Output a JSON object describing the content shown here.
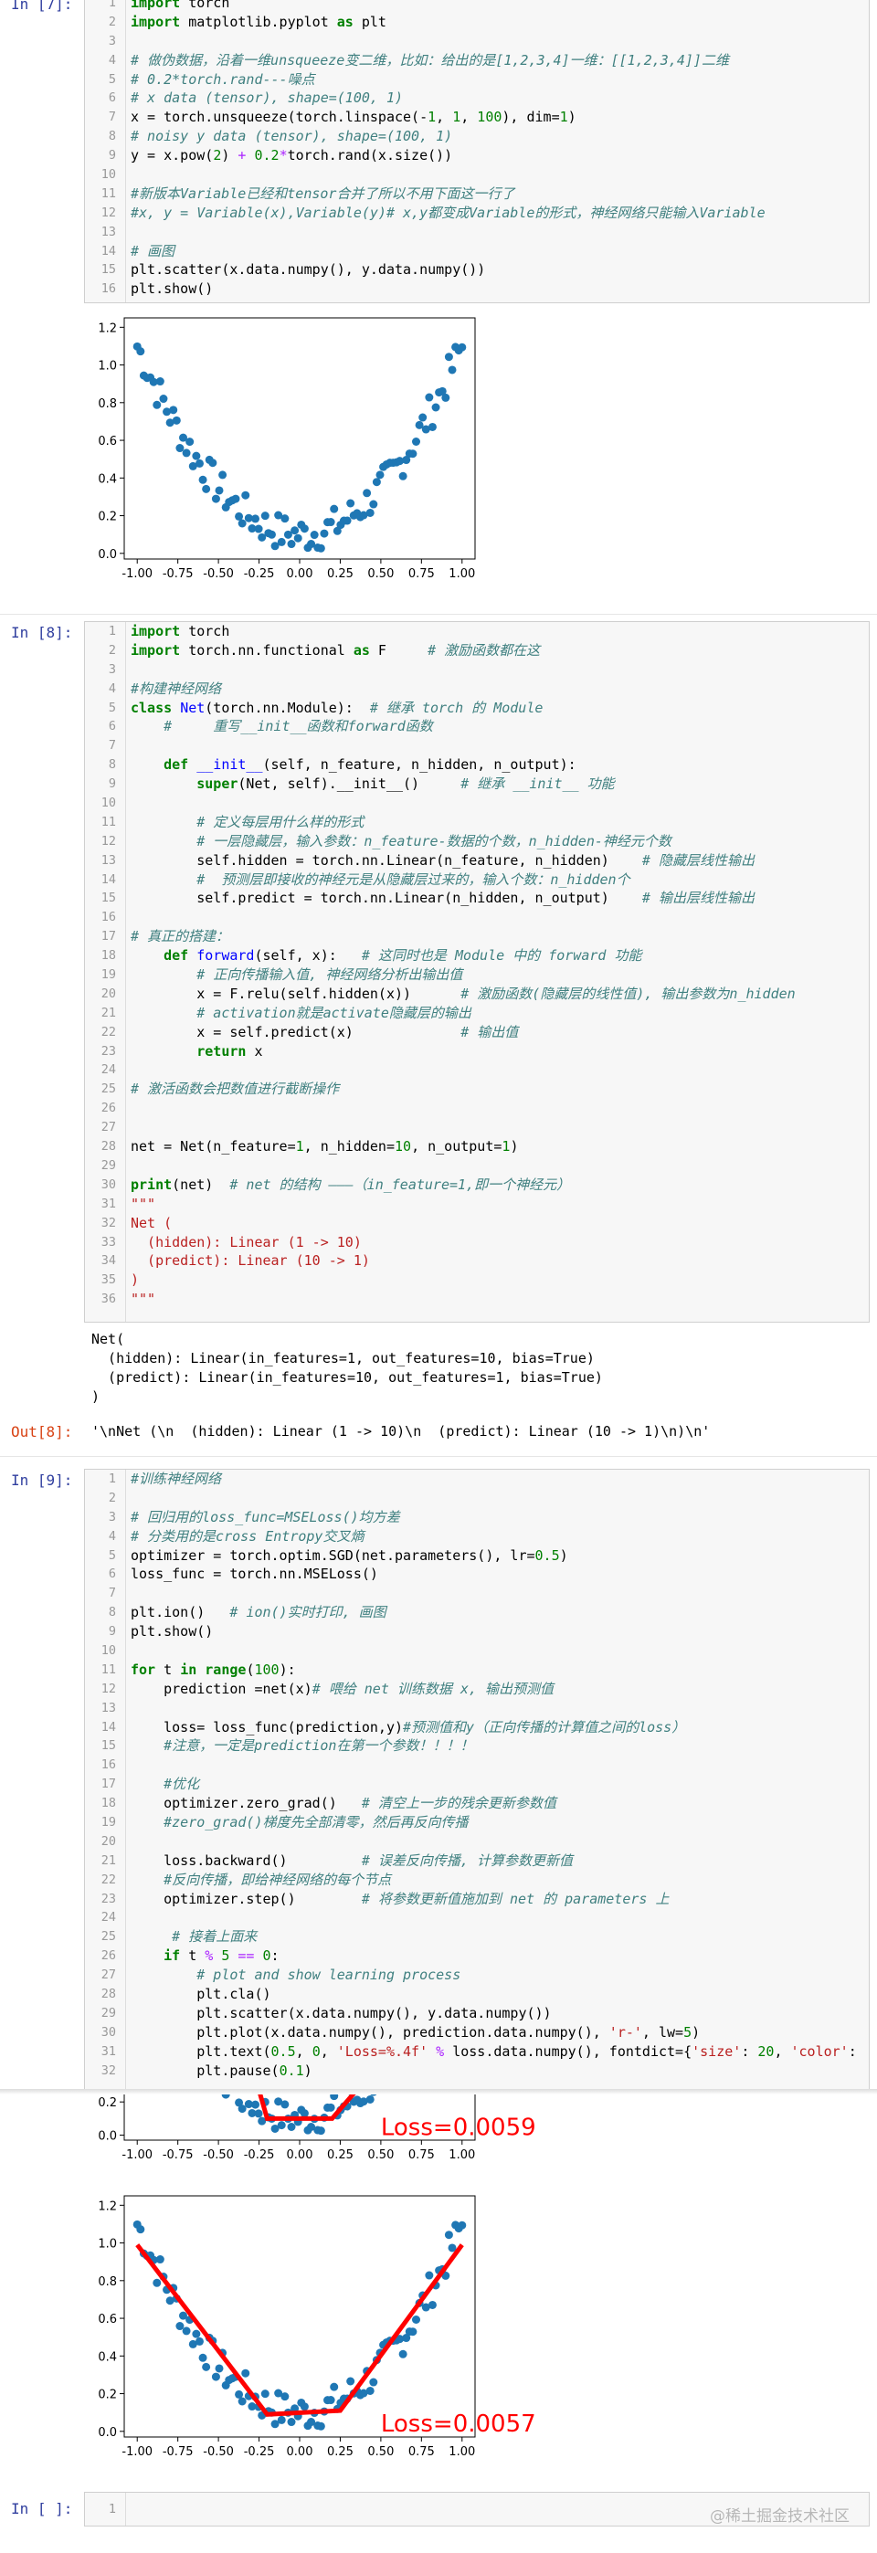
{
  "cells": [
    {
      "prompt": "In [7]:",
      "lines": [
        [
          [
            "kw",
            "import"
          ],
          [
            "t",
            " torch"
          ]
        ],
        [
          [
            "kw",
            "import"
          ],
          [
            "t",
            " matplotlib.pyplot "
          ],
          [
            "kw",
            "as"
          ],
          [
            "t",
            " plt"
          ]
        ],
        [
          [
            "t",
            ""
          ]
        ],
        [
          [
            "cm",
            "# 做伪数据，沿着一维unsqueeze变二维，比如：给出的是[1,2,3,4]一维：[[1,2,3,4]]二维"
          ]
        ],
        [
          [
            "cm",
            "# 0.2*torch.rand---噪点"
          ]
        ],
        [
          [
            "cm",
            "# x data (tensor), shape=(100, 1)"
          ]
        ],
        [
          [
            "t",
            "x = torch.unsqueeze(torch.linspace(-"
          ],
          [
            "num",
            "1"
          ],
          [
            "t",
            ", "
          ],
          [
            "num",
            "1"
          ],
          [
            "t",
            ", "
          ],
          [
            "num",
            "100"
          ],
          [
            "t",
            "), dim="
          ],
          [
            "num",
            "1"
          ],
          [
            "t",
            ")"
          ]
        ],
        [
          [
            "cm",
            "# noisy y data (tensor), shape=(100, 1)"
          ]
        ],
        [
          [
            "t",
            "y = x.pow("
          ],
          [
            "num",
            "2"
          ],
          [
            "t",
            ") "
          ],
          [
            "op",
            "+"
          ],
          [
            "t",
            " "
          ],
          [
            "num",
            "0.2"
          ],
          [
            "op",
            "*"
          ],
          [
            "t",
            "torch.rand(x.size())"
          ]
        ],
        [
          [
            "t",
            ""
          ]
        ],
        [
          [
            "cm",
            "#新版本Variable已经和tensor合并了所以不用下面这一行了"
          ]
        ],
        [
          [
            "cm",
            "#x, y = Variable(x),Variable(y)# x,y都变成Variable的形式，神经网络只能输入Variable"
          ]
        ],
        [
          [
            "t",
            ""
          ]
        ],
        [
          [
            "cm",
            "# 画图"
          ]
        ],
        [
          [
            "t",
            "plt.scatter(x.data.numpy(), y.data.numpy())"
          ]
        ],
        [
          [
            "t",
            "plt.show()"
          ]
        ]
      ]
    },
    {
      "prompt": "In [8]:",
      "lines": [
        [
          [
            "kw",
            "import"
          ],
          [
            "t",
            " torch"
          ]
        ],
        [
          [
            "kw",
            "import"
          ],
          [
            "t",
            " torch.nn.functional "
          ],
          [
            "kw",
            "as"
          ],
          [
            "t",
            " F     "
          ],
          [
            "cm",
            "# 激励函数都在这"
          ]
        ],
        [
          [
            "t",
            ""
          ]
        ],
        [
          [
            "cm",
            "#构建神经网络"
          ]
        ],
        [
          [
            "kw",
            "class"
          ],
          [
            "t",
            " "
          ],
          [
            "fn",
            "Net"
          ],
          [
            "t",
            "(torch.nn.Module):  "
          ],
          [
            "cm",
            "# 继承 torch 的 Module"
          ]
        ],
        [
          [
            "t",
            "    "
          ],
          [
            "cm",
            "#     重写__init__函数和forward函数"
          ]
        ],
        [
          [
            "t",
            ""
          ]
        ],
        [
          [
            "t",
            "    "
          ],
          [
            "kw",
            "def"
          ],
          [
            "t",
            " "
          ],
          [
            "fn",
            "__init__"
          ],
          [
            "t",
            "(self, n_feature, n_hidden, n_output):"
          ]
        ],
        [
          [
            "t",
            "        "
          ],
          [
            "kw",
            "super"
          ],
          [
            "t",
            "(Net, self).__init__()     "
          ],
          [
            "cm",
            "# 继承 __init__ 功能"
          ]
        ],
        [
          [
            "t",
            ""
          ]
        ],
        [
          [
            "t",
            "        "
          ],
          [
            "cm",
            "# 定义每层用什么样的形式"
          ]
        ],
        [
          [
            "t",
            "        "
          ],
          [
            "cm",
            "# 一层隐藏层，输入参数：n_feature-数据的个数，n_hidden-神经元个数"
          ]
        ],
        [
          [
            "t",
            "        self.hidden = torch.nn.Linear(n_feature, n_hidden)    "
          ],
          [
            "cm",
            "# 隐藏层线性输出"
          ]
        ],
        [
          [
            "t",
            "        "
          ],
          [
            "cm",
            "#  预测层即接收的神经元是从隐藏层过来的，输入个数：n_hidden个"
          ]
        ],
        [
          [
            "t",
            "        self.predict = torch.nn.Linear(n_hidden, n_output)    "
          ],
          [
            "cm",
            "# 输出层线性输出"
          ]
        ],
        [
          [
            "t",
            ""
          ]
        ],
        [
          [
            "cm",
            "# 真正的搭建："
          ]
        ],
        [
          [
            "t",
            "    "
          ],
          [
            "kw",
            "def"
          ],
          [
            "t",
            " "
          ],
          [
            "fn",
            "forward"
          ],
          [
            "t",
            "(self, x):   "
          ],
          [
            "cm",
            "# 这同时也是 Module 中的 forward 功能"
          ]
        ],
        [
          [
            "t",
            "        "
          ],
          [
            "cm",
            "# 正向传播输入值, 神经网络分析出输出值"
          ]
        ],
        [
          [
            "t",
            "        x = F.relu(self.hidden(x))      "
          ],
          [
            "cm",
            "# 激励函数(隐藏层的线性值), 输出参数为n_hidden"
          ]
        ],
        [
          [
            "t",
            "        "
          ],
          [
            "cm",
            "# activation就是activate隐藏层的输出"
          ]
        ],
        [
          [
            "t",
            "        x = self.predict(x)             "
          ],
          [
            "cm",
            "# 输出值"
          ]
        ],
        [
          [
            "t",
            "        "
          ],
          [
            "kw",
            "return"
          ],
          [
            "t",
            " x"
          ]
        ],
        [
          [
            "t",
            ""
          ]
        ],
        [
          [
            "cm",
            "# 激活函数会把数值进行截断操作"
          ]
        ],
        [
          [
            "t",
            ""
          ]
        ],
        [
          [
            "t",
            ""
          ]
        ],
        [
          [
            "t",
            "net = Net(n_feature="
          ],
          [
            "num",
            "1"
          ],
          [
            "t",
            ", n_hidden="
          ],
          [
            "num",
            "10"
          ],
          [
            "t",
            ", n_output="
          ],
          [
            "num",
            "1"
          ],
          [
            "t",
            ")"
          ]
        ],
        [
          [
            "t",
            ""
          ]
        ],
        [
          [
            "kw",
            "print"
          ],
          [
            "t",
            "(net)  "
          ],
          [
            "cm",
            "# net 的结构 ———（in_feature=1,即一个神经元）"
          ]
        ],
        [
          [
            "str",
            "\"\"\""
          ]
        ],
        [
          [
            "str",
            "Net ("
          ]
        ],
        [
          [
            "str",
            "  (hidden): Linear (1 -> 10)"
          ]
        ],
        [
          [
            "str",
            "  (predict): Linear (10 -> 1)"
          ]
        ],
        [
          [
            "str",
            ")"
          ]
        ],
        [
          [
            "str",
            "\"\"\""
          ]
        ]
      ],
      "stdout": "Net(\n  (hidden): Linear(in_features=1, out_features=10, bias=True)\n  (predict): Linear(in_features=10, out_features=1, bias=True)\n)",
      "out_prompt": "Out[8]:",
      "out_value": "'\\nNet (\\n  (hidden): Linear (1 -> 10)\\n  (predict): Linear (10 -> 1)\\n)\\n'"
    },
    {
      "prompt": "In [9]:",
      "lines": [
        [
          [
            "cm",
            "#训练神经网络"
          ]
        ],
        [
          [
            "t",
            ""
          ]
        ],
        [
          [
            "cm",
            "# 回归用的loss_func=MSELoss()均方差"
          ]
        ],
        [
          [
            "cm",
            "# 分类用的是cross Entropy交叉熵"
          ]
        ],
        [
          [
            "t",
            "optimizer = torch.optim.SGD(net.parameters(), lr="
          ],
          [
            "num",
            "0.5"
          ],
          [
            "t",
            ")"
          ]
        ],
        [
          [
            "t",
            "loss_func = torch.nn.MSELoss()"
          ]
        ],
        [
          [
            "t",
            ""
          ]
        ],
        [
          [
            "t",
            "plt.ion()   "
          ],
          [
            "cm",
            "# ion()实时打印, 画图"
          ]
        ],
        [
          [
            "t",
            "plt.show()"
          ]
        ],
        [
          [
            "t",
            ""
          ]
        ],
        [
          [
            "kw",
            "for"
          ],
          [
            "t",
            " t "
          ],
          [
            "kw",
            "in"
          ],
          [
            "t",
            " "
          ],
          [
            "kw",
            "range"
          ],
          [
            "t",
            "("
          ],
          [
            "num",
            "100"
          ],
          [
            "t",
            "):"
          ]
        ],
        [
          [
            "t",
            "    prediction =net(x)"
          ],
          [
            "cm",
            "# 喂给 net 训练数据 x, 输出预测值"
          ]
        ],
        [
          [
            "t",
            ""
          ]
        ],
        [
          [
            "t",
            "    loss= loss_func(prediction,y)"
          ],
          [
            "cm",
            "#预测值和y（正向传播的计算值之间的loss）"
          ]
        ],
        [
          [
            "t",
            "    "
          ],
          [
            "cm",
            "#注意，一定是prediction在第一个参数！！！！"
          ]
        ],
        [
          [
            "t",
            ""
          ]
        ],
        [
          [
            "t",
            "    "
          ],
          [
            "cm",
            "#优化"
          ]
        ],
        [
          [
            "t",
            "    optimizer.zero_grad()   "
          ],
          [
            "cm",
            "# 清空上一步的残余更新参数值"
          ]
        ],
        [
          [
            "t",
            "    "
          ],
          [
            "cm",
            "#zero_grad()梯度先全部清零，然后再反向传播"
          ]
        ],
        [
          [
            "t",
            ""
          ]
        ],
        [
          [
            "t",
            "    loss.backward()         "
          ],
          [
            "cm",
            "# 误差反向传播, 计算参数更新值"
          ]
        ],
        [
          [
            "t",
            "    "
          ],
          [
            "cm",
            "#反向传播，即给神经网络的每个节点"
          ]
        ],
        [
          [
            "t",
            "    optimizer.step()        "
          ],
          [
            "cm",
            "# 将参数更新值施加到 net 的 parameters 上"
          ]
        ],
        [
          [
            "t",
            ""
          ]
        ],
        [
          [
            "t",
            "     "
          ],
          [
            "cm",
            "# 接着上面来"
          ]
        ],
        [
          [
            "t",
            "    "
          ],
          [
            "kw",
            "if"
          ],
          [
            "t",
            " t "
          ],
          [
            "op",
            "%"
          ],
          [
            "t",
            " "
          ],
          [
            "num",
            "5"
          ],
          [
            "t",
            " "
          ],
          [
            "op",
            "=="
          ],
          [
            "t",
            " "
          ],
          [
            "num",
            "0"
          ],
          [
            "t",
            ":"
          ]
        ],
        [
          [
            "t",
            "        "
          ],
          [
            "cm",
            "# plot and show learning process"
          ]
        ],
        [
          [
            "t",
            "        plt.cla()"
          ]
        ],
        [
          [
            "t",
            "        plt.scatter(x.data.numpy(), y.data.numpy())"
          ]
        ],
        [
          [
            "t",
            "        plt.plot(x.data.numpy(), prediction.data.numpy(), "
          ],
          [
            "str",
            "'r-'"
          ],
          [
            "t",
            ", lw="
          ],
          [
            "num",
            "5"
          ],
          [
            "t",
            ")"
          ]
        ],
        [
          [
            "t",
            "        plt.text("
          ],
          [
            "num",
            "0.5"
          ],
          [
            "t",
            ", "
          ],
          [
            "num",
            "0"
          ],
          [
            "t",
            ", "
          ],
          [
            "str",
            "'Loss=%.4f'"
          ],
          [
            "t",
            " "
          ],
          [
            "op",
            "%"
          ],
          [
            "t",
            " loss.data.numpy(), fontdict={"
          ],
          [
            "str",
            "'size'"
          ],
          [
            "t",
            ": "
          ],
          [
            "num",
            "20"
          ],
          [
            "t",
            ", "
          ],
          [
            "str",
            "'color'"
          ],
          [
            "t",
            ":  "
          ],
          [
            "str",
            "'"
          ]
        ],
        [
          [
            "t",
            "        plt.pause("
          ],
          [
            "num",
            "0.1"
          ],
          [
            "t",
            ")"
          ]
        ]
      ]
    },
    {
      "prompt": "In  [ ]:",
      "lines": [
        [
          [
            "t",
            ""
          ]
        ]
      ]
    }
  ],
  "plot_loss_1": "Loss=0.0059",
  "plot_loss_2": "Loss=0.0057",
  "chart_data": [
    {
      "type": "scatter",
      "xlim": [
        -1.0,
        1.0
      ],
      "ylim": [
        0.0,
        1.2
      ],
      "xticks": [
        "-1.00",
        "-0.75",
        "-0.50",
        "-0.25",
        "0.00",
        "0.25",
        "0.50",
        "0.75",
        "1.00"
      ],
      "yticks": [
        "0.0",
        "0.2",
        "0.4",
        "0.6",
        "0.8",
        "1.0",
        "1.2"
      ],
      "color": "#1f77b4"
    },
    {
      "type": "line",
      "series_color": "#ff0000",
      "text": "Loss=0.0059",
      "xticks": [
        "-1.00",
        "-0.75",
        "-0.50",
        "-0.25",
        "0.00",
        "0.25",
        "0.50",
        "0.75",
        "1.00"
      ],
      "yticks": [
        "0.2",
        "0.0"
      ],
      "line_x": [
        -0.25,
        -0.2,
        0.2,
        0.35
      ],
      "line_y": [
        0.27,
        0.1,
        0.1,
        0.27
      ]
    },
    {
      "type": "line",
      "series_color": "#ff0000",
      "text": "Loss=0.0057",
      "xticks": [
        "-1.00",
        "-0.75",
        "-0.50",
        "-0.25",
        "0.00",
        "0.25",
        "0.50",
        "0.75",
        "1.00"
      ],
      "yticks": [
        "0.0",
        "0.2",
        "0.4",
        "0.6",
        "0.8",
        "1.0",
        "1.2"
      ],
      "line_x": [
        -1.0,
        -0.2,
        0.25,
        1.0
      ],
      "line_y": [
        0.99,
        0.09,
        0.11,
        0.99
      ]
    }
  ],
  "watermark": "@稀土掘金技术社区"
}
